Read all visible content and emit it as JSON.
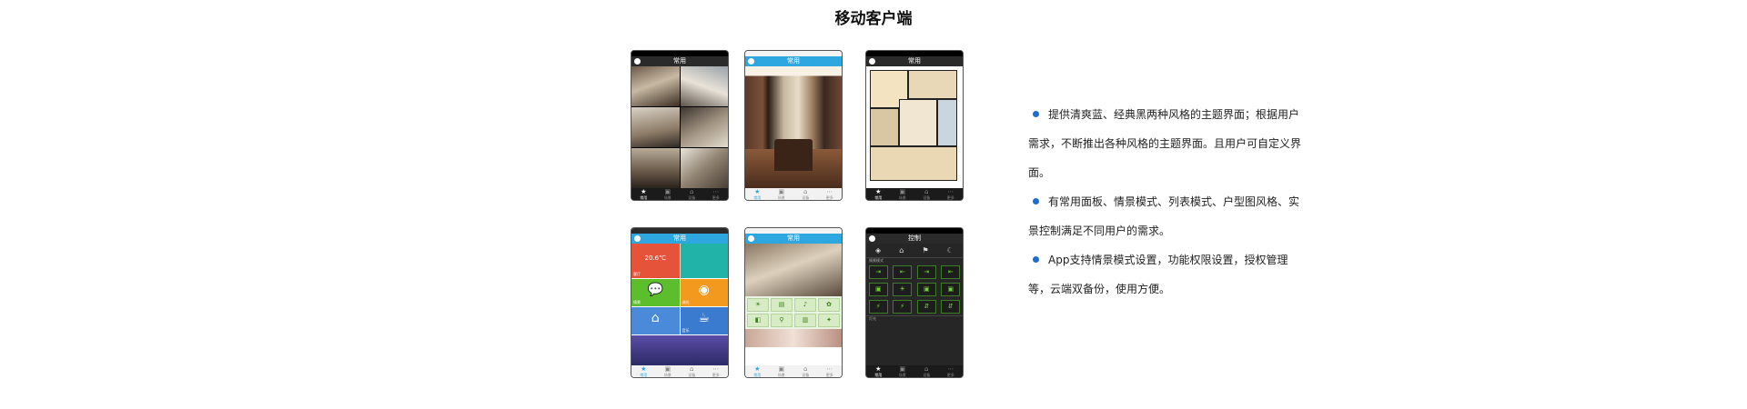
{
  "title": "移动客户端",
  "phones": {
    "p1": {
      "header": "常用",
      "tabs": [
        "常用",
        "场景",
        "设备",
        "更多"
      ]
    },
    "p2": {
      "header": "常用",
      "tabs": [
        "常用",
        "场景",
        "设备",
        "更多"
      ]
    },
    "p3": {
      "header": "常用",
      "tabs": [
        "常用",
        "场景",
        "设备",
        "更多"
      ]
    },
    "p4": {
      "header": "常用",
      "temp": "20.6℃",
      "tile_labels": [
        "客厅",
        "情景",
        "调光",
        "音乐"
      ],
      "tabs": [
        "常用",
        "场景",
        "设备",
        "更多"
      ]
    },
    "p5": {
      "header": "常用",
      "tabs": [
        "常用",
        "场景",
        "设备",
        "更多"
      ]
    },
    "p6": {
      "header": "控制",
      "section1": "情景模式",
      "section2": "灯光",
      "tabs": [
        "常用",
        "场景",
        "设备",
        "更多"
      ]
    }
  },
  "bullets": [
    "提供清爽蓝、经典黑两种风格的主题界面；根据用户需求，不断推出各种风格的主题界面。且用户可自定义界面。",
    "有常用面板、情景模式、列表模式、户型图风格、实景控制满足不同用户的需求。",
    "App支持情景模式设置，功能权限设置，授权管理等，云端双备份，使用方便。"
  ],
  "colors": {
    "accent_blue": "#2ea7e0",
    "bullet_blue": "#1a6fd1"
  }
}
